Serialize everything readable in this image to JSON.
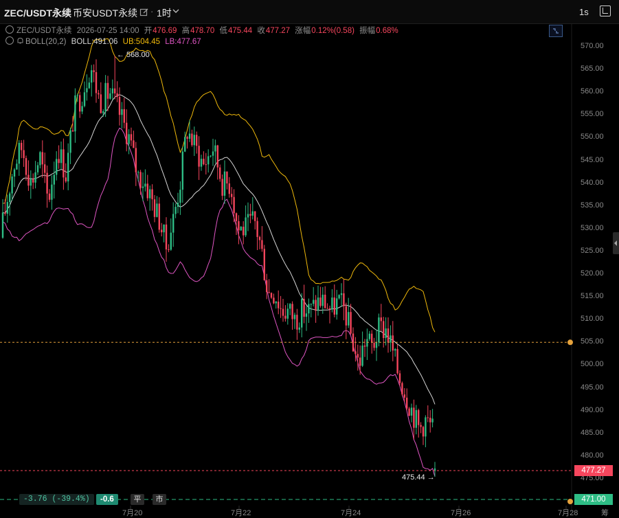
{
  "topbar": {
    "symbol": "ZEC/USDT永续",
    "exchange": "币安USDT永续",
    "timeframe": "1时",
    "refresh_label": "1s"
  },
  "legend": {
    "symbol": "ZEC/USDT永续",
    "datetime": "2026-07-25 14:00",
    "open_label": "开",
    "open": "476.69",
    "high_label": "高",
    "high": "478.70",
    "low_label": "低",
    "low": "475.44",
    "close_label": "收",
    "close": "477.27",
    "change_label": "涨幅",
    "change": "0.12%(0.58)",
    "amplitude_label": "振幅",
    "amplitude": "0.68%"
  },
  "indicator": {
    "name": "BOLL(20,2)",
    "mid": "BOLL:491.06",
    "upper": "UB:504.45",
    "lower": "LB:477.67"
  },
  "axis": {
    "y_ticks": [
      "570.00",
      "565.00",
      "560.00",
      "555.00",
      "550.00",
      "545.00",
      "540.00",
      "535.00",
      "530.00",
      "525.00",
      "520.00",
      "515.00",
      "510.00",
      "505.00",
      "500.00",
      "495.00",
      "490.00",
      "485.00",
      "480.00",
      "475.00"
    ],
    "x_ticks": [
      "7月20",
      "7月22",
      "7月24",
      "7月26",
      "7月28"
    ],
    "tail_label": "筹"
  },
  "markers": {
    "high_label": "← 568.00",
    "low_label": "475.44 →",
    "last_price": "477.27",
    "alert_price": "471.00"
  },
  "bottom": {
    "pnl": "-3.76 (-39.4%)",
    "pos": "-0.6",
    "close_btn": "平",
    "market_btn": "市"
  },
  "colors": {
    "up": "#2ebd85",
    "down": "#f6465d",
    "ub": "#f0b90b",
    "lb": "#e056c4",
    "mid": "#d6d6d6",
    "alert": "#e6a23c"
  },
  "chart_data": {
    "type": "candlestick",
    "y_range": [
      472,
      572
    ],
    "x_range": [
      "7月19",
      "7月28"
    ],
    "high": 568.0,
    "low": 475.44,
    "last_price": 477.27,
    "alert_line": 505.0,
    "boll_last": {
      "mid": 491.06,
      "upper": 504.45,
      "lower": 477.67
    }
  }
}
